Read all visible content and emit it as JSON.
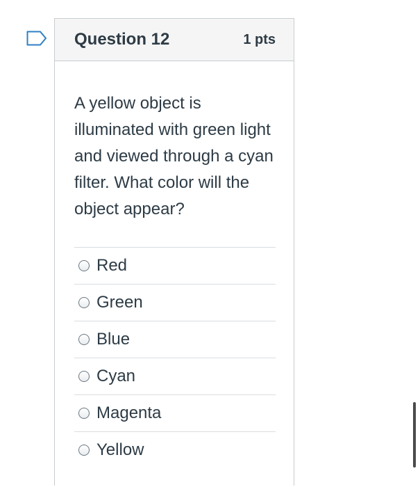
{
  "question": {
    "title": "Question 12",
    "points": "1 pts",
    "text": "A yellow object is illuminated with green light and viewed through a cyan filter. What color will the object appear?",
    "answers": [
      {
        "label": "Red"
      },
      {
        "label": "Green"
      },
      {
        "label": "Blue"
      },
      {
        "label": "Cyan"
      },
      {
        "label": "Magenta"
      },
      {
        "label": "Yellow"
      }
    ]
  },
  "icons": {
    "flag": "flag-icon"
  },
  "colors": {
    "flag_stroke": "#2d7fc4",
    "text": "#2d3b45",
    "header_bg": "#f5f5f5",
    "border": "#c7cdd1"
  }
}
